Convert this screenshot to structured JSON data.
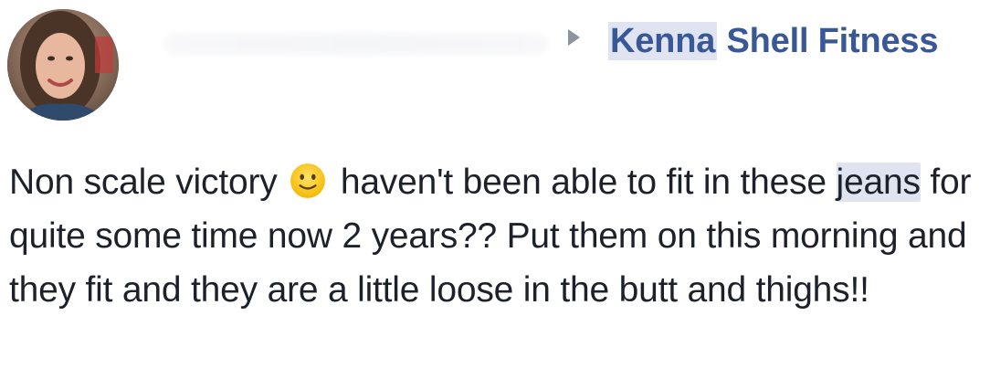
{
  "post": {
    "avatar_icon": "profile-photo",
    "arrow_icon": "triangle-right-icon",
    "group_name_part1": "Kenna",
    "group_name_part2": " Shell Fitness",
    "text": {
      "seg1": "Non scale victory ",
      "emoji_icon": "slightly-smiling-face-emoji",
      "seg2": " haven't been able to fit in these ",
      "jeans": "jeans",
      "seg3": " for quite some time now 2 years?? Put them on this morning and they fit and they are a little loose in the butt and thighs!!"
    },
    "colors": {
      "link": "#385898",
      "text": "#1d2129",
      "highlight": "#dfe4f0",
      "arrow": "#8d949e"
    }
  }
}
